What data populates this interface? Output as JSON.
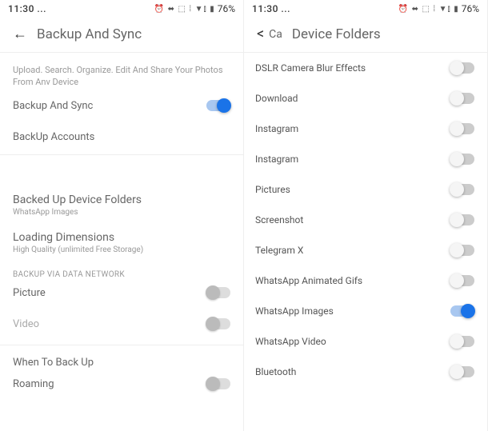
{
  "left": {
    "status": {
      "time": "11:30 ...",
      "icons": "⏰ ⬌ ⬚ ⁞ ▼⫾ ▮",
      "battery": "76%"
    },
    "header": {
      "title": "Backup And Sync"
    },
    "desc": "Upload. Search. Organize. Edit And Share Your Photos From Anv Device",
    "backup_sync": {
      "label": "Backup And Sync",
      "on": true
    },
    "backup_accounts": {
      "label": "BackUp Accounts"
    },
    "backed_folders": {
      "title": "Backed Up Device Folders",
      "sub": "WhatsApp Images"
    },
    "dimensions": {
      "title": "Loading Dimensions",
      "sub": "High Quality (unlimited Free Storage)"
    },
    "section_data": "BACKUP VIA DATA NETWORK",
    "picture": {
      "label": "Picture",
      "on": false
    },
    "video": {
      "label": "Video",
      "on": false
    },
    "when": "When To Back Up",
    "roaming": {
      "label": "Roaming",
      "on": false
    }
  },
  "right": {
    "status": {
      "time": "11:30 ...",
      "icons": "⏰ ⬌ ⬚ ⁞ ▼⫾ ▮",
      "battery": "76%"
    },
    "header": {
      "back": "Ca",
      "title": "Device Folders"
    },
    "folders": [
      {
        "label": "DSLR Camera Blur Effects",
        "on": false
      },
      {
        "label": "Download",
        "on": false
      },
      {
        "label": "Instagram",
        "on": false
      },
      {
        "label": "Instagram",
        "on": false
      },
      {
        "label": "Pictures",
        "on": false
      },
      {
        "label": "Screenshot",
        "on": false
      },
      {
        "label": "Telegram X",
        "on": false
      },
      {
        "label": "WhatsApp Animated Gifs",
        "on": false
      },
      {
        "label": "WhatsApp Images",
        "on": true
      },
      {
        "label": "WhatsApp Video",
        "on": false
      },
      {
        "label": "Bluetooth",
        "on": false
      }
    ]
  }
}
